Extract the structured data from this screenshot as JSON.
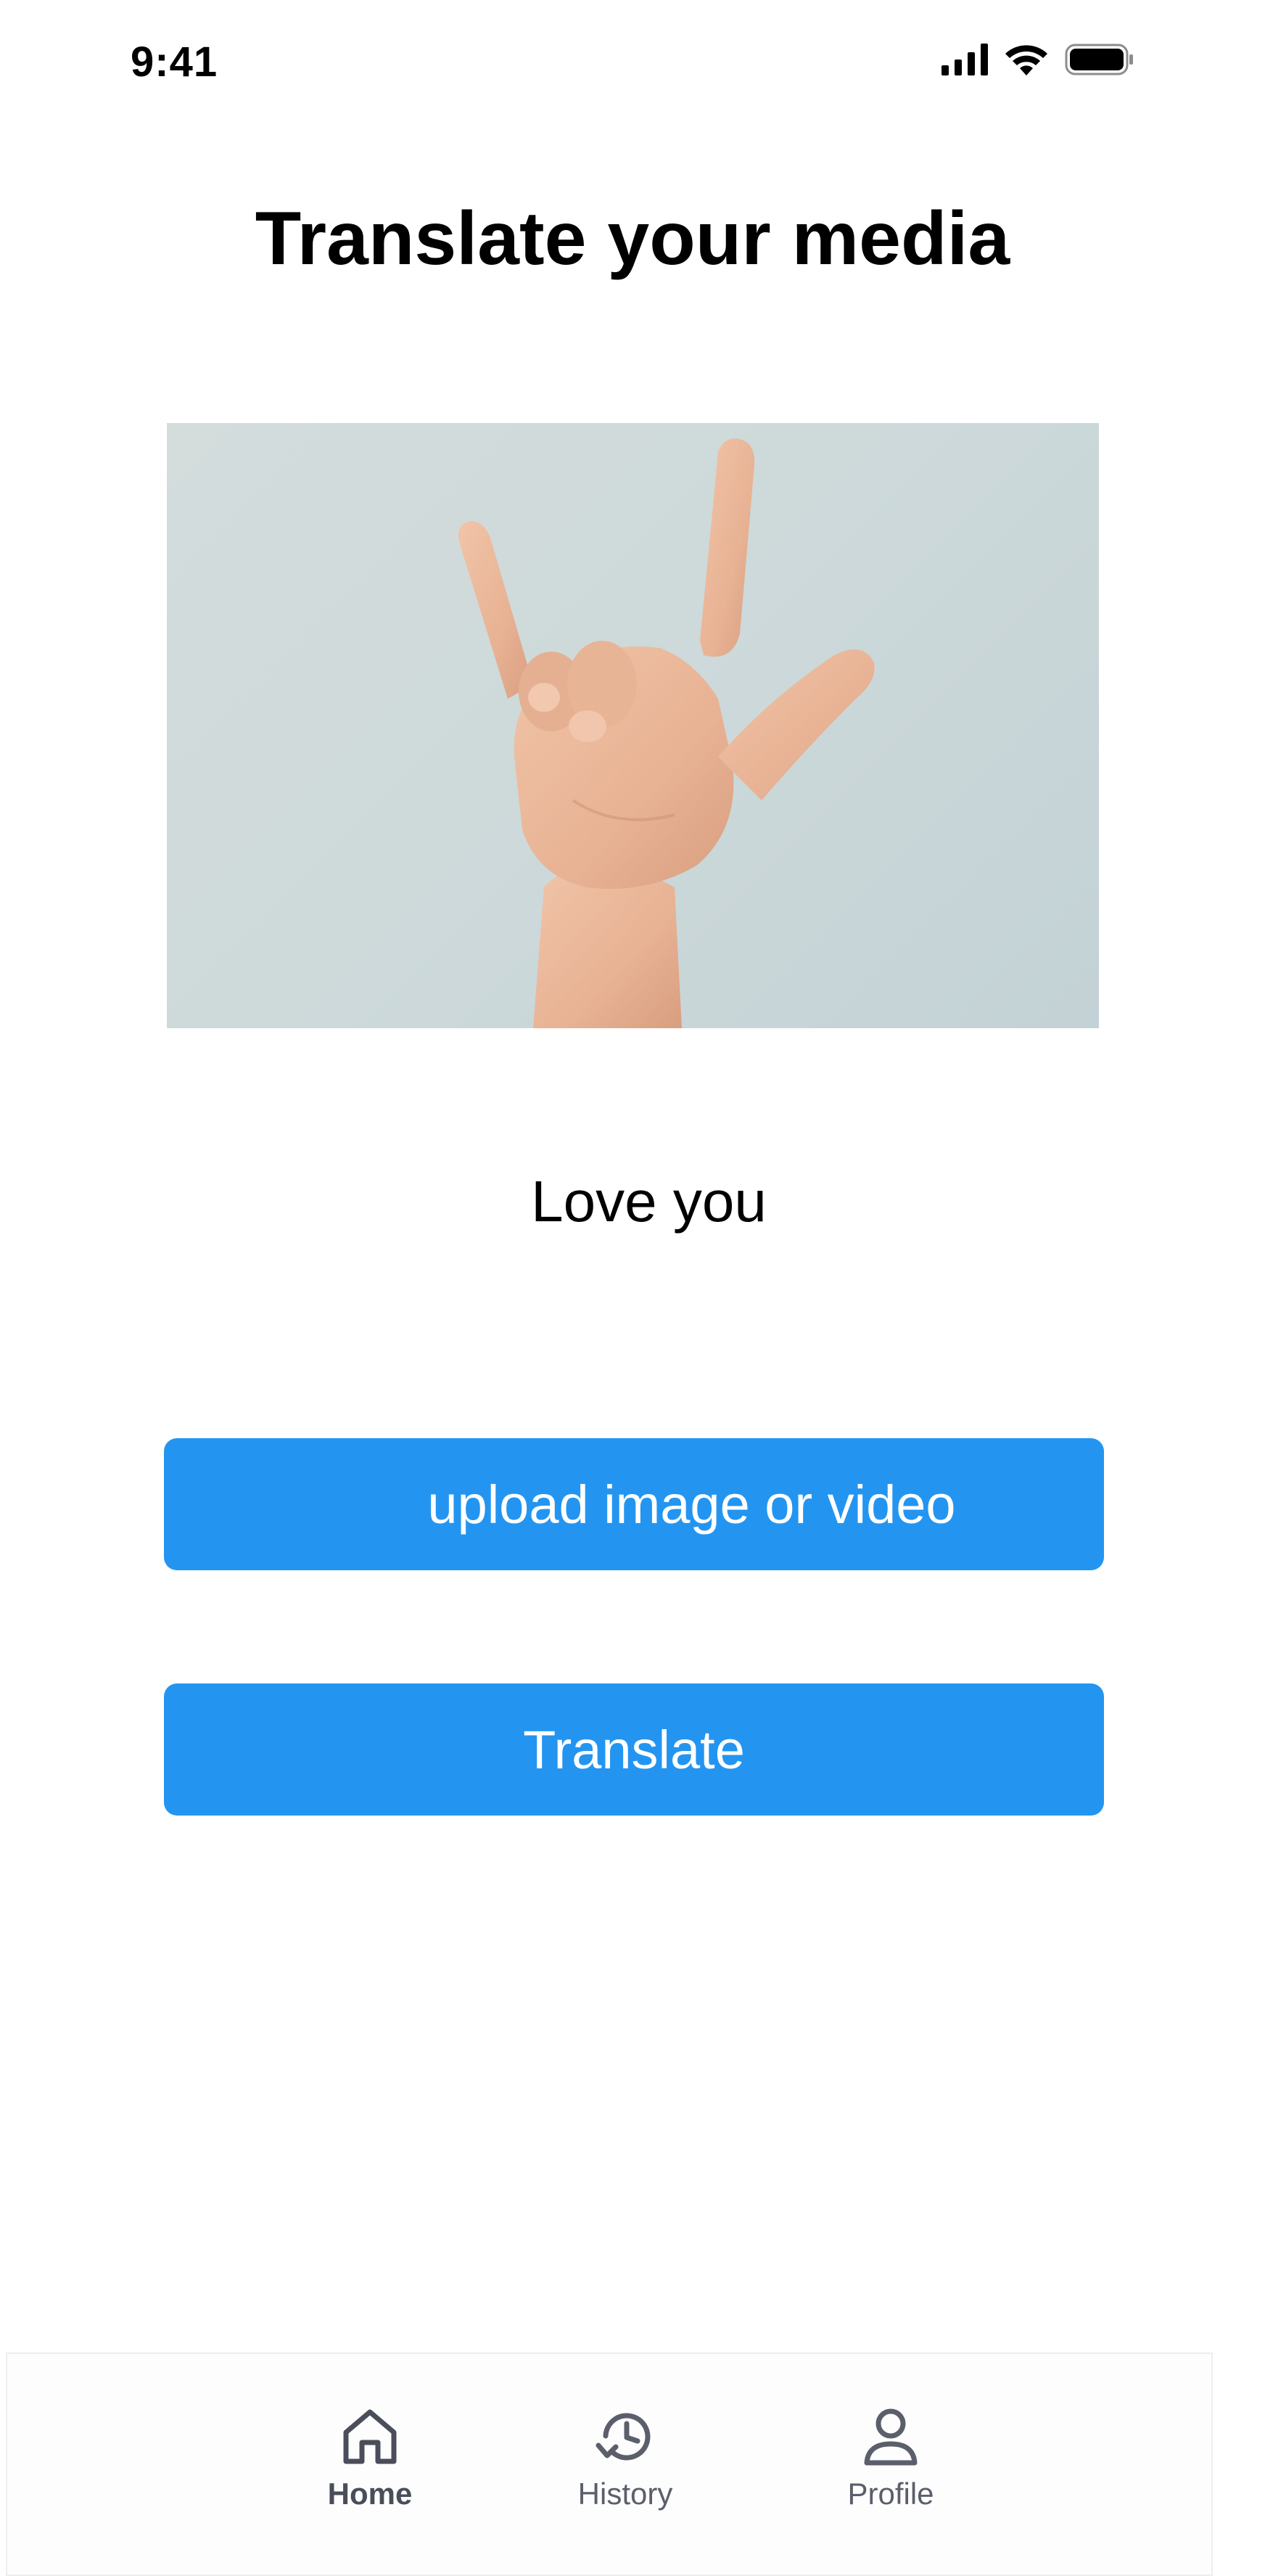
{
  "status_bar": {
    "time": "9:41",
    "icons": [
      "cellular-signal-icon",
      "wifi-icon",
      "battery-icon"
    ]
  },
  "page": {
    "title": "Translate your media"
  },
  "media": {
    "description_icon": "hand-sign-photo"
  },
  "result": {
    "text": "Love you"
  },
  "buttons": {
    "upload_label": "upload image or video",
    "translate_label": "Translate",
    "color": "#2395F1"
  },
  "nav": {
    "items": [
      {
        "label": "Home",
        "icon": "home-icon",
        "active": true
      },
      {
        "label": "History",
        "icon": "history-icon",
        "active": false
      },
      {
        "label": "Profile",
        "icon": "profile-icon",
        "active": false
      }
    ]
  }
}
